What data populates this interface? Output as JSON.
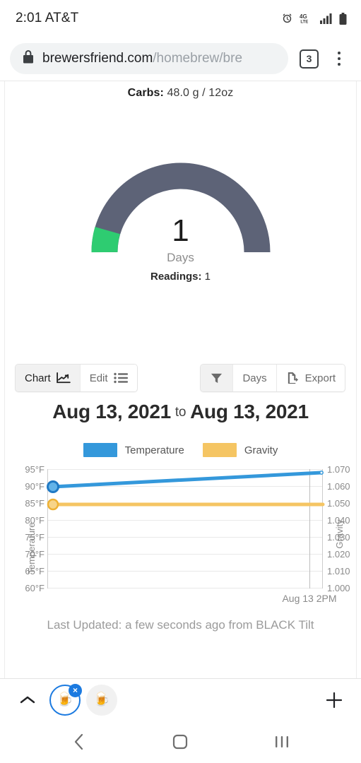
{
  "statusbar": {
    "time": "2:01",
    "carrier": "AT&T",
    "network": "4G LTE",
    "icons": [
      "alarm-icon",
      "network-4glte-icon",
      "signal-bars-icon",
      "battery-icon"
    ]
  },
  "browser": {
    "url_domain": "brewersfriend.com",
    "url_path": "/homebrew/bre",
    "tab_count": "3",
    "lock_icon": "lock-icon",
    "menu_icon": "overflow-menu-icon"
  },
  "content": {
    "carbs_label": "Carbs:",
    "carbs_value": "48.0 g / 12oz",
    "gauge": {
      "value": "1",
      "unit": "Days",
      "readings_label": "Readings:",
      "readings_value": "1",
      "track_color": "#5d6377",
      "progress_color": "#2ecc71",
      "progress_fraction": 0.09
    },
    "view_toggle": {
      "chart_label": "Chart",
      "chart_icon": "line-chart-icon",
      "edit_label": "Edit",
      "edit_icon": "list-icon",
      "active": "Chart"
    },
    "tools": {
      "filter_icon": "filter-funnel-icon",
      "days_label": "Days",
      "export_label": "Export",
      "export_icon": "file-export-icon"
    },
    "date_range": {
      "start": "Aug 13, 2021",
      "separator": "to",
      "end": "Aug 13, 2021"
    },
    "last_updated": "Last Updated: a few seconds ago from BLACK Tilt"
  },
  "chart_data": {
    "type": "line",
    "title": "",
    "xlabel": "",
    "x": [
      "Aug 13 2PM"
    ],
    "xtick_labels": [
      "Aug 13 2PM"
    ],
    "grid": true,
    "legend_position": "top-center",
    "series": [
      {
        "name": "Temperature",
        "color": "#3498db",
        "axis": "left",
        "unit": "°F",
        "values": [
          90,
          94
        ],
        "points": [
          {
            "x": 0.0,
            "y": 90
          },
          {
            "x": 1.0,
            "y": 94
          }
        ]
      },
      {
        "name": "Gravity",
        "color": "#f5c563",
        "axis": "right",
        "unit": "SG",
        "values": [
          1.05,
          1.05
        ],
        "points": [
          {
            "x": 0.0,
            "y": 1.05
          },
          {
            "x": 1.0,
            "y": 1.05
          }
        ]
      }
    ],
    "left_axis": {
      "label": "Temperature",
      "ylim": [
        60,
        95
      ],
      "ticks": [
        95,
        90,
        85,
        80,
        75,
        70,
        65,
        60
      ],
      "tick_labels": [
        "95°F",
        "90°F",
        "85°F",
        "80°F",
        "75°F",
        "70°F",
        "65°F",
        "60°F"
      ]
    },
    "right_axis": {
      "label": "Gravity",
      "ylim": [
        1.0,
        1.07
      ],
      "ticks": [
        1.07,
        1.06,
        1.05,
        1.04,
        1.03,
        1.02,
        1.01,
        1.0
      ],
      "tick_labels": [
        "1.070",
        "1.060",
        "1.050",
        "1.040",
        "1.030",
        "1.020",
        "1.010",
        "1.000"
      ]
    }
  },
  "tabstrip": {
    "collapse_icon": "chevron-up-icon",
    "tabs": [
      {
        "favicon": "beer-mug-icon",
        "selected": true,
        "close_label": "×"
      },
      {
        "favicon": "beer-mug-icon",
        "selected": false
      }
    ],
    "new_tab_icon": "plus-icon"
  },
  "navbar": {
    "back_icon": "back-chevron-icon",
    "home_icon": "home-square-icon",
    "recents_icon": "recents-bars-icon"
  }
}
